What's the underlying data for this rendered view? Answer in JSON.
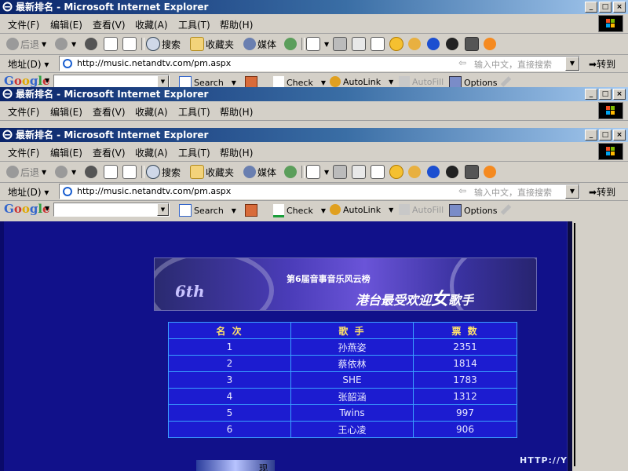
{
  "window": {
    "title": "最新排名 - Microsoft Internet Explorer",
    "buttons": [
      "_",
      "□",
      "×"
    ]
  },
  "menu": [
    "文件(F)",
    "编辑(E)",
    "查看(V)",
    "收藏(A)",
    "工具(T)",
    "帮助(H)"
  ],
  "toolbar": {
    "back": "后退",
    "search": "搜索",
    "favorites": "收藏夹",
    "media": "媒体"
  },
  "address": {
    "label": "地址(D)",
    "url": "http://music.netandtv.com/pm.aspx",
    "hint": "输入中文，直接搜索",
    "go": "转到"
  },
  "google_bar": {
    "logo": [
      "G",
      "o",
      "o",
      "g",
      "l",
      "e"
    ],
    "search_label": "Search",
    "check_label": "Check",
    "autolink_label": "AutoLink",
    "autofill_label": "AutoFill",
    "options_label": "Options"
  },
  "banner": {
    "badge": "6th",
    "line1": "第6届音事音乐风云榜",
    "line2_pre": "港台最受欢迎",
    "line2_big": "女",
    "line2_post": "歌手"
  },
  "table": {
    "headers": [
      "名 次",
      "歌 手",
      "票 数"
    ],
    "rows": [
      [
        "1",
        "孙燕姿",
        "2351"
      ],
      [
        "2",
        "蔡依林",
        "1814"
      ],
      [
        "3",
        "SHE",
        "1783"
      ],
      [
        "4",
        "张韶涵",
        "1312"
      ],
      [
        "5",
        "Twins",
        "997"
      ],
      [
        "6",
        "王心凌",
        "906"
      ]
    ]
  },
  "thumb_char": "现",
  "watermark": "HTTP://YAN.COM"
}
